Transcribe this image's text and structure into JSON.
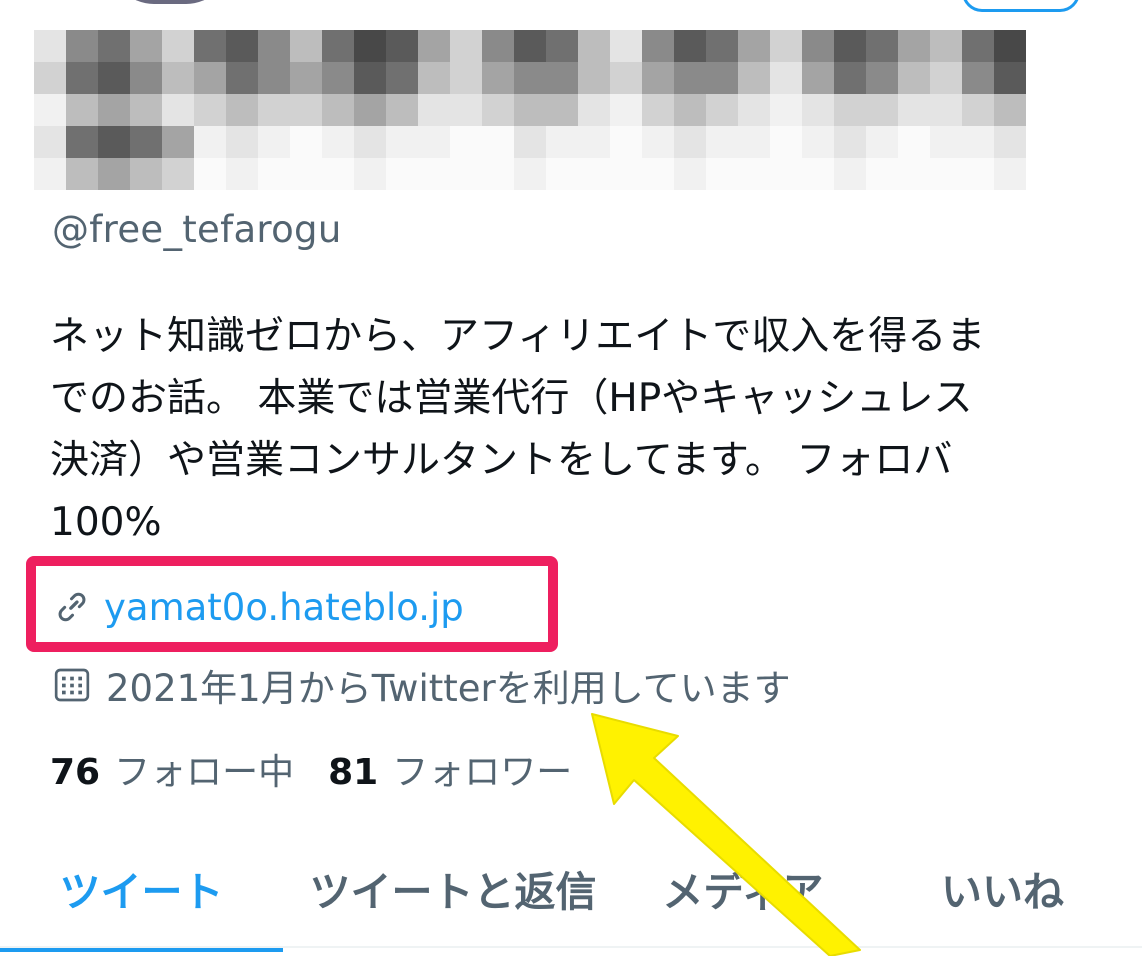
{
  "profile": {
    "handle": "@free_tefarogu",
    "bio_lines": [
      "ネット知識ゼロから、アフィリエイトで収入を得るま",
      "でのお話。 本業では営業代行（HPやキャッシュレス",
      "決済）や営業コンサルタントをしてます。 フォロバ",
      "100%"
    ],
    "link": "yamat0o.hateblo.jp",
    "joined": "2021年1月からTwitterを利用しています",
    "following_count": "76",
    "following_label": "フォロー中",
    "followers_count": "81",
    "followers_label": "フォロワー"
  },
  "tabs": [
    {
      "label": "ツイート",
      "active": true
    },
    {
      "label": "ツイートと返信",
      "active": false
    },
    {
      "label": "メディア",
      "active": false
    },
    {
      "label": "いいね",
      "active": false
    }
  ],
  "icons": {
    "link": "link-icon",
    "calendar": "calendar-icon"
  },
  "colors": {
    "accent": "#1d9bf0",
    "secondary_text": "#536471",
    "highlight_box": "#ee1f5f",
    "arrow": "#fff200"
  }
}
